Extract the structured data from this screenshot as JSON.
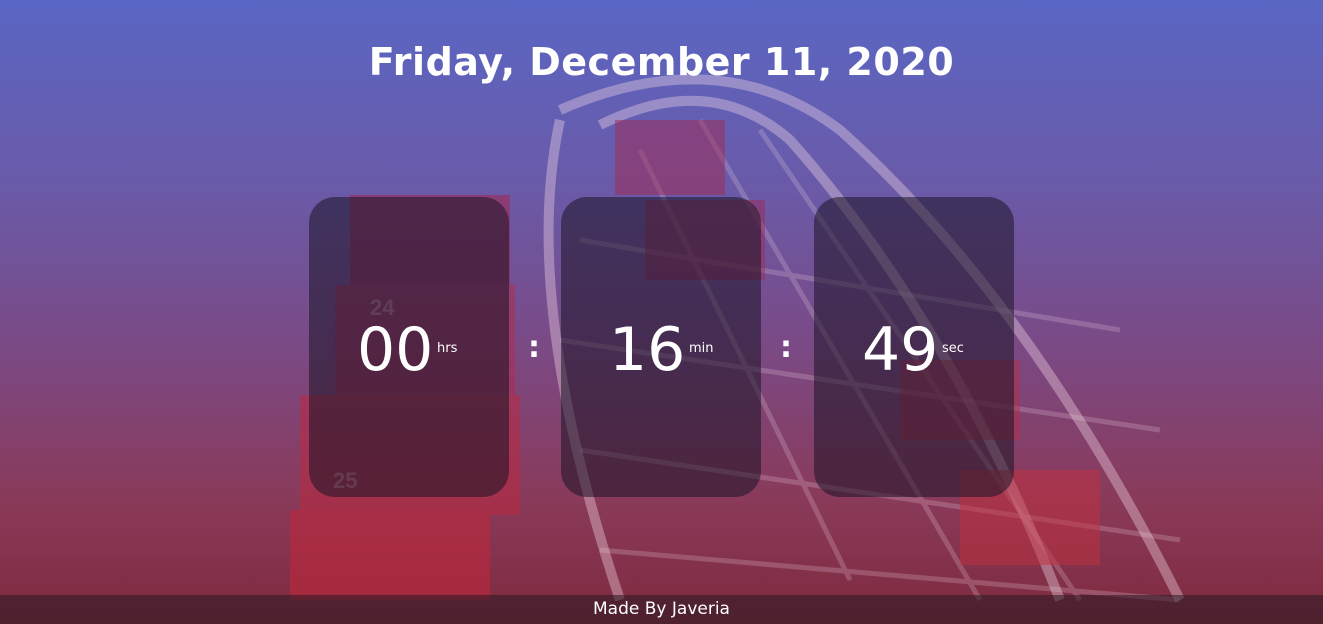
{
  "header": {
    "date": "Friday, December 11, 2020"
  },
  "timer": {
    "hours": {
      "value": "00",
      "unit": "hrs"
    },
    "minutes": {
      "value": "16",
      "unit": "min"
    },
    "seconds": {
      "value": "49",
      "unit": "sec"
    },
    "separator": ":"
  },
  "footer": {
    "credit": "Made By Javeria"
  },
  "background": {
    "image": "ferris-wheel",
    "gradient_top": "#5a66c4",
    "gradient_bottom": "#7e2a3e",
    "cabin_numbers": [
      "24",
      "25"
    ]
  }
}
